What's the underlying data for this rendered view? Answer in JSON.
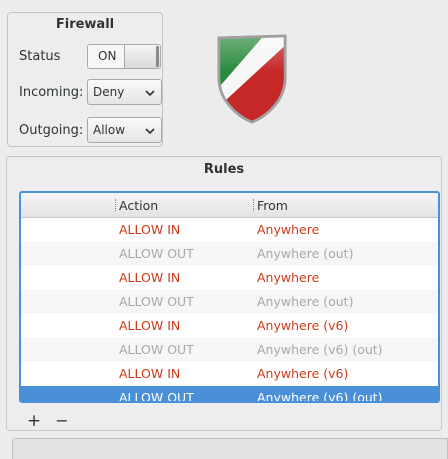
{
  "firewall": {
    "title": "Firewall",
    "status_label": "Status",
    "status_value": "ON",
    "incoming_label": "Incoming:",
    "incoming_value": "Deny",
    "outgoing_label": "Outgoing:",
    "outgoing_value": "Allow"
  },
  "logo": {
    "icon": "gufw-shield-icon",
    "colors": [
      "#2b8a3e",
      "#ffffff",
      "#c62828"
    ]
  },
  "rules": {
    "title": "Rules",
    "columns": {
      "action": "Action",
      "from": "From"
    },
    "rows": [
      {
        "action": "ALLOW IN",
        "from": "Anywhere",
        "style": "active"
      },
      {
        "action": "ALLOW OUT",
        "from": "Anywhere (out)",
        "style": "inactive"
      },
      {
        "action": "ALLOW IN",
        "from": "Anywhere",
        "style": "active"
      },
      {
        "action": "ALLOW OUT",
        "from": "Anywhere (out)",
        "style": "inactive"
      },
      {
        "action": "ALLOW IN",
        "from": "Anywhere (v6)",
        "style": "active"
      },
      {
        "action": "ALLOW OUT",
        "from": "Anywhere (v6) (out)",
        "style": "inactive"
      },
      {
        "action": "ALLOW IN",
        "from": "Anywhere (v6)",
        "style": "active"
      },
      {
        "action": "ALLOW OUT",
        "from": "Anywhere (v6) (out)",
        "style": "selected"
      }
    ],
    "add_label": "+",
    "remove_label": "−"
  },
  "colors": {
    "accent": "#4a90d9",
    "active_text": "#cc3b1a",
    "inactive_text": "#a8a8a8"
  }
}
